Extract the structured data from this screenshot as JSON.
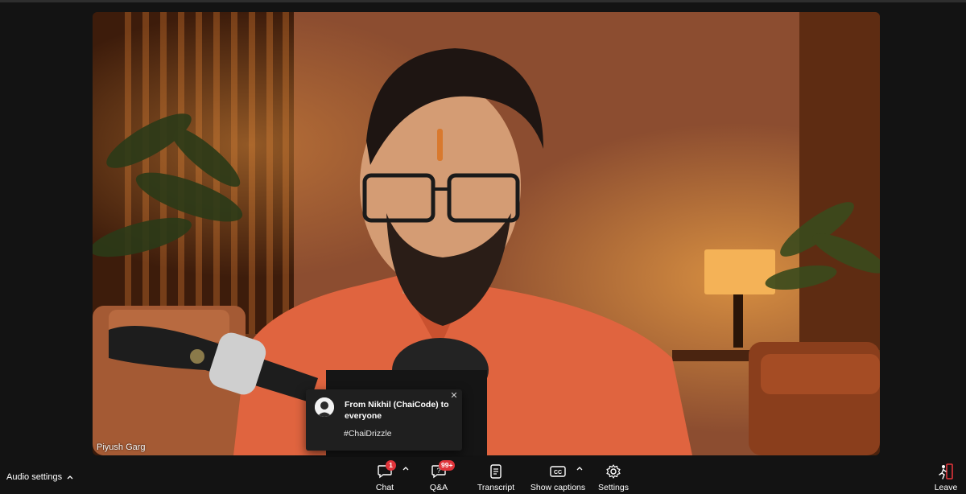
{
  "participant": {
    "name": "Piyush Garg"
  },
  "notification": {
    "title": "From Nikhil (ChaiCode) to everyone",
    "message": "#ChaiDrizzle",
    "close_icon": "close-icon",
    "avatar_icon": "person-avatar-icon"
  },
  "audio_settings": {
    "label": "Audio settings",
    "icon": "chevron-up-icon"
  },
  "controls": {
    "chat": {
      "label": "Chat",
      "badge": "1",
      "icon": "chat-bubble-icon"
    },
    "qa": {
      "label": "Q&A",
      "badge": "99+",
      "icon": "qa-bubble-icon"
    },
    "transcript": {
      "label": "Transcript",
      "icon": "transcript-icon"
    },
    "captions": {
      "label": "Show captions",
      "icon": "cc-icon"
    },
    "settings": {
      "label": "Settings",
      "icon": "gear-icon"
    },
    "leave": {
      "label": "Leave",
      "icon": "leave-icon",
      "accent": "#e0343a"
    }
  },
  "colors": {
    "badge": "#e0343a",
    "bar": "#131313",
    "toast": "#1f1f1f"
  }
}
